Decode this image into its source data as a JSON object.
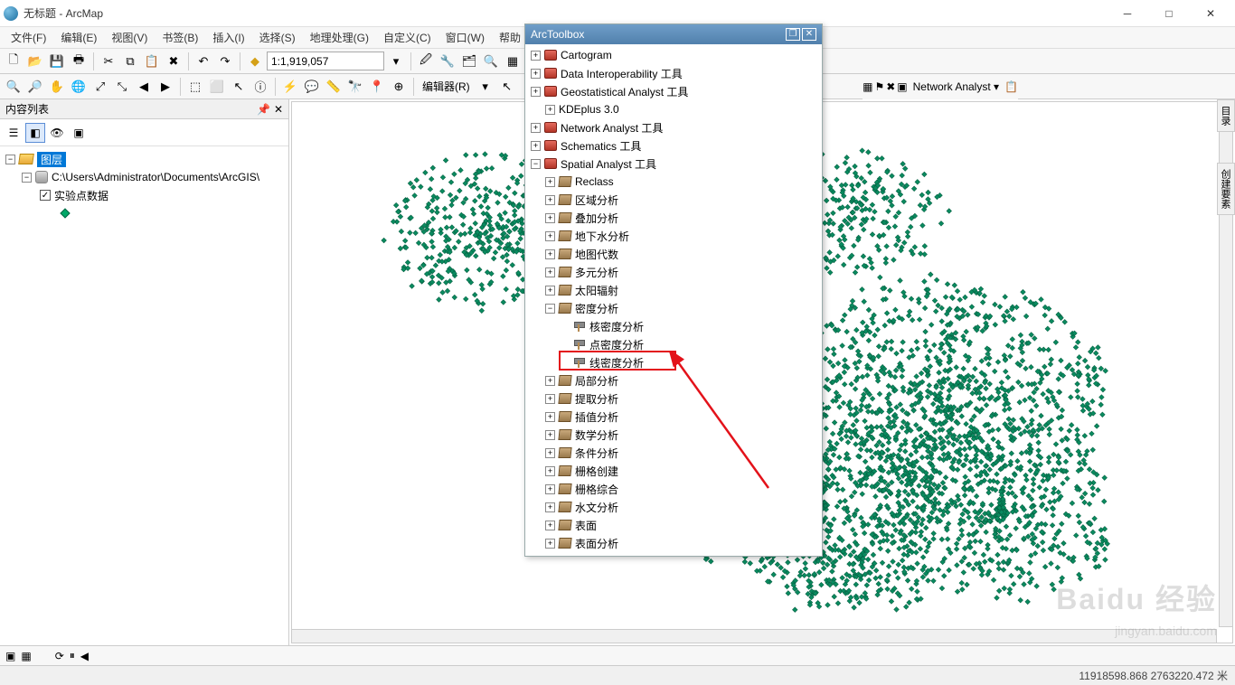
{
  "window": {
    "title": "无标题 - ArcMap"
  },
  "menu": [
    "文件(F)",
    "编辑(E)",
    "视图(V)",
    "书签(B)",
    "插入(I)",
    "选择(S)",
    "地理处理(G)",
    "自定义(C)",
    "窗口(W)",
    "帮助"
  ],
  "scale": "1:1,919,057",
  "editor_label": "编辑器(R)",
  "network_label": "Network Analyst",
  "toc": {
    "title": "内容列表",
    "layers": "图层",
    "path": "C:\\Users\\Administrator\\Documents\\ArcGIS\\",
    "dataset": "实验点数据"
  },
  "arctoolbox": {
    "title": "ArcToolbox",
    "roots": [
      {
        "label": "Cartogram",
        "type": "tbox"
      },
      {
        "label": "Data Interoperability 工具",
        "type": "tbox"
      },
      {
        "label": "Geostatistical Analyst 工具",
        "type": "tbox"
      },
      {
        "label": "KDEplus 3.0",
        "type": "none",
        "indent": 1
      },
      {
        "label": "Network Analyst 工具",
        "type": "tbox"
      },
      {
        "label": "Schematics 工具",
        "type": "tbox"
      }
    ],
    "spatial": "Spatial Analyst 工具",
    "spatial_children": [
      "Reclass",
      "区域分析",
      "叠加分析",
      "地下水分析",
      "地图代数",
      "多元分析",
      "太阳辐射"
    ],
    "density": "密度分析",
    "density_tools": [
      "核密度分析",
      "点密度分析",
      "线密度分析"
    ],
    "spatial_rest": [
      "局部分析",
      "提取分析",
      "插值分析",
      "数学分析",
      "条件分析",
      "栅格创建",
      "栅格综合",
      "水文分析",
      "表面",
      "表面分析"
    ]
  },
  "status": {
    "coord": "11918598.868  2763220.472 米"
  },
  "sidetabs": [
    "目录",
    "创建要素"
  ],
  "watermark": {
    "brand": "Baidu 经验",
    "url": "jingyan.baidu.com"
  }
}
